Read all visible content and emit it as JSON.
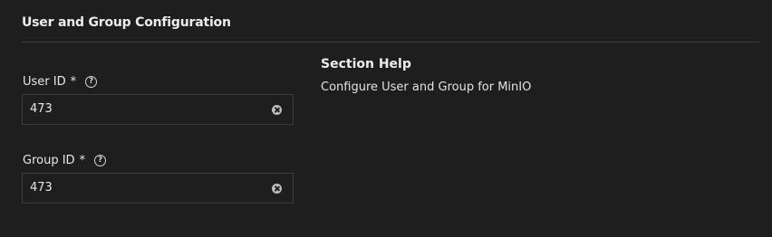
{
  "section": {
    "title": "User and Group Configuration"
  },
  "fields": [
    {
      "label": "User ID",
      "required_marker": "*",
      "help_icon": "?",
      "value": "473"
    },
    {
      "label": "Group ID",
      "required_marker": "*",
      "help_icon": "?",
      "value": "473"
    }
  ],
  "help": {
    "title": "Section Help",
    "text": "Configure User and Group for MinIO"
  },
  "colors": {
    "background": "#1e1e1e",
    "divider": "#3a3a3a",
    "input_border": "#3c3c3c",
    "text": "#e6e6e6"
  }
}
